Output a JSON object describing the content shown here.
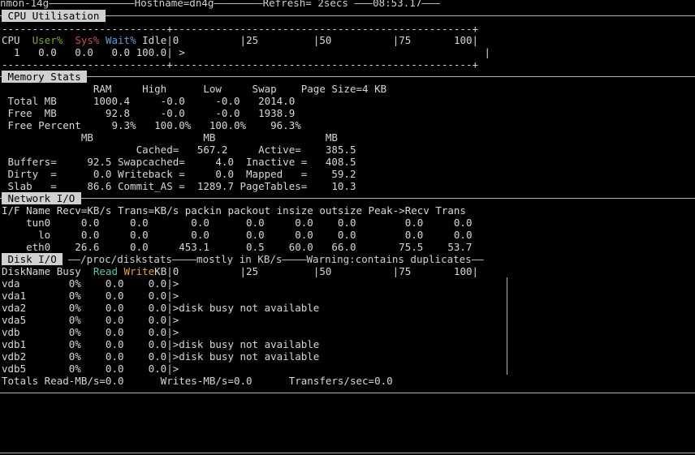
{
  "header": {
    "title_text": "nmon-14g——————————————Hostname=dn4g————————Refresh= 2secs ———08:53.17———"
  },
  "cpu": {
    "section_label": " CPU Utilisation ",
    "dash_line": "---------------------------+-------------------------------------------------+",
    "header_cpu": "CPU  ",
    "header_user": "User%",
    "header_sys": "Sys%",
    "header_wait": "Wait%",
    "header_rest": " Idle|0          |25         |50          |75       100|",
    "row": "  1   0.0   0.0   0.0 100.0| >                                                 |",
    "dash_line_bottom": "---------------------------+-------------------------------------------------+"
  },
  "memory": {
    "section_label": " Memory Stats ",
    "lines": [
      "               RAM     High      Low     Swap    Page Size=4 KB",
      " Total MB      1000.4     -0.0     -0.0   2014.0",
      " Free  MB        92.8     -0.0     -0.0   1938.9",
      " Free Percent     9.3%   100.0%   100.0%    96.3%",
      "             MB                  MB                  MB",
      "                      Cached=   567.2     Active=    385.5",
      " Buffers=     92.5 Swapcached=     4.0  Inactive =   408.5",
      " Dirty  =      0.0 Writeback =     0.0  Mapped   =    59.2",
      " Slab   =     86.6 Commit_AS =  1289.7 PageTables=    10.3"
    ]
  },
  "network": {
    "section_label": " Network I/O ",
    "lines": [
      "I/F Name Recv=KB/s Trans=KB/s packin packout insize outsize Peak->Recv Trans",
      "    tun0     0.0     0.0       0.0      0.0     0.0    0.0        0.0     0.0",
      "      lo     0.0     0.0       0.0      0.0     0.0    0.0        0.0     0.0",
      "    eth0    26.6     0.0     453.1      0.5    60.0   66.0       75.5    53.7"
    ]
  },
  "disk": {
    "section_label": " Disk I/O ",
    "title_rest": "——/proc/diskstats————mostly in KB/s————Warning:contains duplicates——",
    "header_name": "DiskName Busy  ",
    "header_read": "Read",
    "header_write": "Write",
    "header_rest": "KB|0          |25         |50          |75       100|",
    "rows": [
      "vda        0%    0.0    0.0|>",
      "vda1       0%    0.0    0.0|>",
      "vda2       0%    0.0    0.0|>disk busy not available",
      "vda5       0%    0.0    0.0|>",
      "vdb        0%    0.0    0.0|>",
      "vdb1       0%    0.0    0.0|>disk busy not available",
      "vdb2       0%    0.0    0.0|>disk busy not available",
      "vdb5       0%    0.0    0.0|>"
    ],
    "totals": "Totals Read-MB/s=0.0      Writes-MB/s=0.0      Transfers/sec=0.0"
  }
}
